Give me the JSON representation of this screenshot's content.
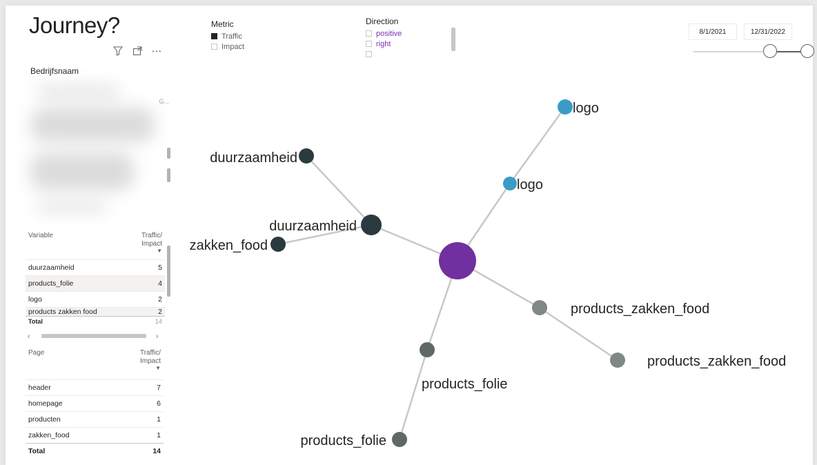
{
  "report": {
    "title": "Journey?",
    "visual_icons": [
      "filter-icon",
      "focus-mode-icon",
      "more-options-icon"
    ]
  },
  "slicers": {
    "metric": {
      "title": "Metric",
      "options": [
        {
          "label": "Traffic",
          "checked": true
        },
        {
          "label": "Impact",
          "checked": false
        }
      ]
    },
    "direction": {
      "title": "Direction",
      "options": [
        {
          "label": "positive",
          "checked": false
        },
        {
          "label": "right",
          "checked": false
        }
      ]
    },
    "date_range": {
      "start": "8/1/2021",
      "end": "12/31/2022"
    },
    "company": {
      "title": "Bedrijfsnaam",
      "truncated_item": "G..."
    }
  },
  "variable_table": {
    "col1": "Variable",
    "col2": "Traffic/ Impact",
    "rows": [
      {
        "name": "duurzaamheid",
        "value": "5"
      },
      {
        "name": "products_folie",
        "value": "4"
      },
      {
        "name": "logo",
        "value": "2"
      },
      {
        "name": "products zakken food",
        "value": "2"
      }
    ],
    "total_label": "Total",
    "total_value": "14"
  },
  "page_table": {
    "col1": "Page",
    "col2": "Traffic/ Impact",
    "rows": [
      {
        "name": "header",
        "value": "7"
      },
      {
        "name": "homepage",
        "value": "6"
      },
      {
        "name": "producten",
        "value": "1"
      },
      {
        "name": "zakken_food",
        "value": "1"
      }
    ],
    "total_label": "Total",
    "total_value": "14"
  },
  "colors": {
    "center_node": "#7030a0",
    "teal_node": "#3a9cc4",
    "dark_node": "#2b3a3e",
    "grey_node": "#7f8887",
    "mid_grey_node": "#5f6866",
    "edge": "#c8c8c8"
  },
  "network": {
    "nodes": [
      {
        "id": "center",
        "label": "",
        "color": "center_node"
      },
      {
        "id": "duurz1",
        "label": "duurzaamheid",
        "color": "dark_node"
      },
      {
        "id": "duurz2",
        "label": "duurzaamheid",
        "color": "dark_node"
      },
      {
        "id": "zakken",
        "label": "zakken_food",
        "color": "dark_node"
      },
      {
        "id": "logo1",
        "label": "logo",
        "color": "teal_node"
      },
      {
        "id": "logo2",
        "label": "logo",
        "color": "teal_node"
      },
      {
        "id": "pzf1",
        "label": "products_zakken_food",
        "color": "grey_node"
      },
      {
        "id": "pzf2",
        "label": "products_zakken_food",
        "color": "grey_node"
      },
      {
        "id": "pf1",
        "label": "products_folie",
        "color": "mid_grey_node"
      },
      {
        "id": "pf2",
        "label": "products_folie",
        "color": "mid_grey_node"
      }
    ],
    "edges": [
      [
        "center",
        "duurz2"
      ],
      [
        "duurz2",
        "duurz1"
      ],
      [
        "duurz2",
        "zakken"
      ],
      [
        "center",
        "logo1"
      ],
      [
        "logo1",
        "logo2"
      ],
      [
        "center",
        "pzf1"
      ],
      [
        "pzf1",
        "pzf2"
      ],
      [
        "center",
        "pf1"
      ],
      [
        "pf1",
        "pf2"
      ]
    ]
  }
}
